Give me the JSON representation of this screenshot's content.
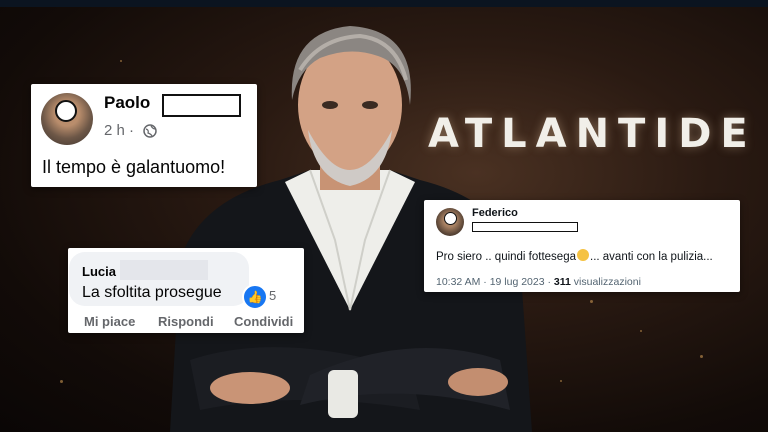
{
  "logo": {
    "text": "ATLANTIDE"
  },
  "facebook_post": {
    "author": "Paolo",
    "time": "2 h ·",
    "globe_icon": "globe-icon",
    "text": "Il tempo è galantuomo!"
  },
  "tweet": {
    "author": "Federico",
    "text_before_emoji": "Pro siero .. quindi fottesega",
    "text_after_emoji": "... avanti con la pulizia...",
    "timestamp": "10:32 AM · 19 lug 2023 ·",
    "views_count": "311",
    "views_label": "visualizzazioni"
  },
  "comment": {
    "author": "Lucia",
    "text": "La sfoltita prosegue",
    "reaction_count": "5",
    "actions": {
      "like": "Mi piace",
      "reply": "Rispondi",
      "share": "Condividi"
    }
  },
  "colors": {
    "facebook_blue": "#1877f2",
    "background_brown": "#2a1a12"
  }
}
